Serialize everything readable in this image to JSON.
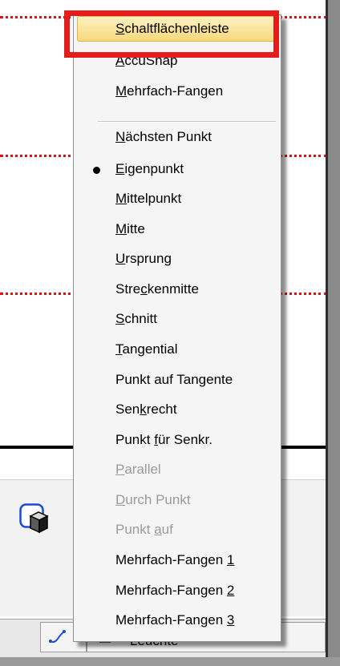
{
  "menu": {
    "items": [
      {
        "pre": "",
        "u": "S",
        "post": "chaltflächenleiste",
        "state": "highlighted"
      },
      {
        "pre": "",
        "u": "A",
        "post": "ccuSnap",
        "state": "normal"
      },
      {
        "pre": "",
        "u": "M",
        "post": "ehrfach-Fangen",
        "state": "normal"
      },
      {
        "pre": "",
        "u": "N",
        "post": "ächsten Punkt",
        "state": "normal"
      },
      {
        "pre": "",
        "u": "E",
        "post": "igenpunkt",
        "state": "checked"
      },
      {
        "pre": "",
        "u": "M",
        "post": "ittelpunkt",
        "state": "normal"
      },
      {
        "pre": "",
        "u": "M",
        "post": "itte",
        "state": "normal"
      },
      {
        "pre": "",
        "u": "U",
        "post": "rsprung",
        "state": "normal"
      },
      {
        "pre": "Stre",
        "u": "c",
        "post": "kenmitte",
        "state": "normal"
      },
      {
        "pre": "",
        "u": "S",
        "post": "chnitt",
        "state": "normal"
      },
      {
        "pre": "",
        "u": "T",
        "post": "angential",
        "state": "normal"
      },
      {
        "pre": "Punkt auf Tan",
        "u": "g",
        "post": "ente",
        "state": "normal"
      },
      {
        "pre": "Sen",
        "u": "k",
        "post": "recht",
        "state": "normal"
      },
      {
        "pre": "Punkt ",
        "u": "f",
        "post": "ür Senkr.",
        "state": "normal"
      },
      {
        "pre": "",
        "u": "P",
        "post": "arallel",
        "state": "disabled"
      },
      {
        "pre": "",
        "u": "D",
        "post": "urch Punkt",
        "state": "disabled"
      },
      {
        "pre": "Punkt ",
        "u": "a",
        "post": "uf",
        "state": "disabled"
      },
      {
        "pre": "Mehrfach-Fangen ",
        "u": "1",
        "post": "",
        "state": "normal"
      },
      {
        "pre": "Mehrfach-Fangen ",
        "u": "2",
        "post": "",
        "state": "normal"
      },
      {
        "pre": "Mehrfach-Fangen ",
        "u": "3",
        "post": "",
        "state": "normal"
      }
    ]
  },
  "statusbar": {
    "level_text": "Leuchte"
  },
  "colors": {
    "highlight_frame": "#e41c1c",
    "dotted_lines": "#e01010",
    "menu_highlight": "#f7d97a",
    "disabled_text": "#9a9a9a"
  },
  "icons": {
    "tool": "cube-in-box-icon",
    "status_snap": "snap-path-icon",
    "status_level": "level-color-icon",
    "checked": "bullet-icon"
  }
}
